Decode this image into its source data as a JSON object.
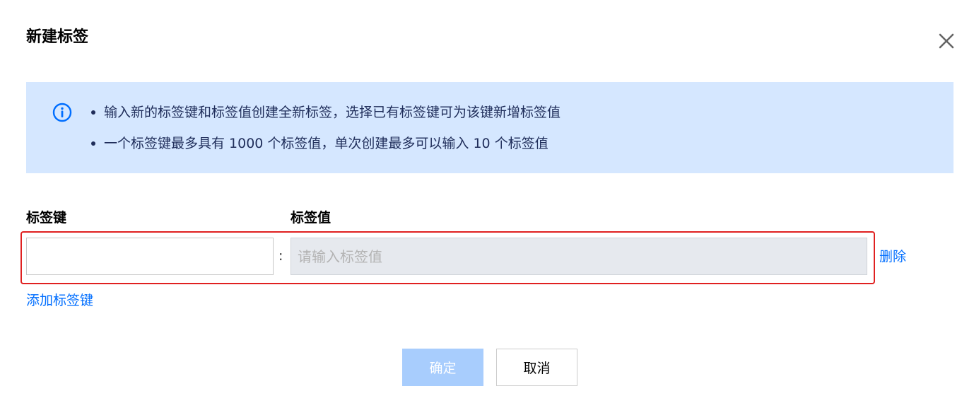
{
  "dialog": {
    "title": "新建标签",
    "close_icon": "close-icon"
  },
  "notice": {
    "icon": "info-icon",
    "color_bg": "#d5e7ff",
    "color_icon": "#006eff",
    "items": [
      "输入新的标签键和标签值创建全新标签，选择已有标签键可为该键新增标签值",
      "一个标签键最多具有 1000 个标签值，单次创建最多可以输入 10 个标签值"
    ]
  },
  "form": {
    "key_label": "标签键",
    "value_label": "标签值",
    "separator": ":",
    "key_value": "",
    "value_placeholder": "请输入标签值",
    "delete_label": "删除",
    "add_key_label": "添加标签键",
    "highlight_color": "#e02020"
  },
  "footer": {
    "confirm_label": "确定",
    "cancel_label": "取消",
    "confirm_color": "#a8cdfd"
  },
  "colors": {
    "link": "#006eff"
  }
}
